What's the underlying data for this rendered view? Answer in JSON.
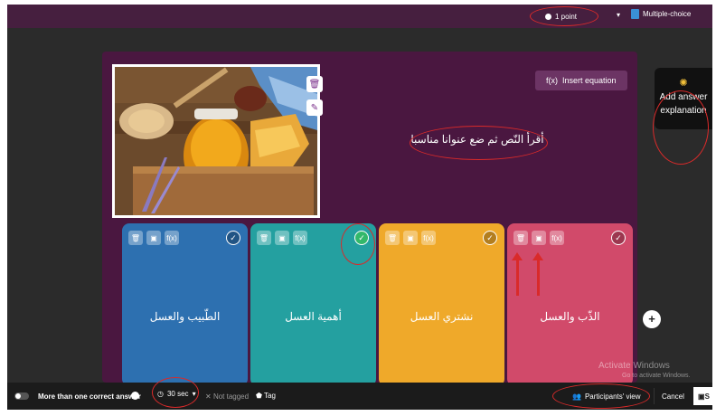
{
  "header": {
    "points": "1 point",
    "question_type": "Multiple-choice"
  },
  "question": {
    "insert_equation": "Insert equation",
    "text": "أقرأ النّص ثم ضع عنوانا مناسبا"
  },
  "answers": [
    {
      "label": "الطّبيب والعسل",
      "color": "#2d70b0",
      "correct": false
    },
    {
      "label": "أهمية العسل",
      "color": "#24a0a0",
      "correct": true
    },
    {
      "label": "نشتري العسل",
      "color": "#efa92a",
      "correct": false
    },
    {
      "label": "الذّب والعسل",
      "color": "#d14a6a",
      "correct": false
    }
  ],
  "answer_tools": [
    "🗑",
    "▣",
    "f(x)"
  ],
  "side_panel": {
    "line1": "Add answer",
    "line2": "explanation"
  },
  "footer": {
    "multi_correct": "More than one correct answer",
    "timer": "30 sec",
    "not_tagged": "Not tagged",
    "tag": "Tag",
    "participants_view": "Participants' view",
    "cancel": "Cancel",
    "save": "S"
  },
  "watermark": {
    "title": "Activate Windows",
    "sub": "Go to activate Windows."
  },
  "colors": {
    "topbar": "#461f3f",
    "panel": "#4a1740",
    "annotation": "#d92a2a"
  }
}
